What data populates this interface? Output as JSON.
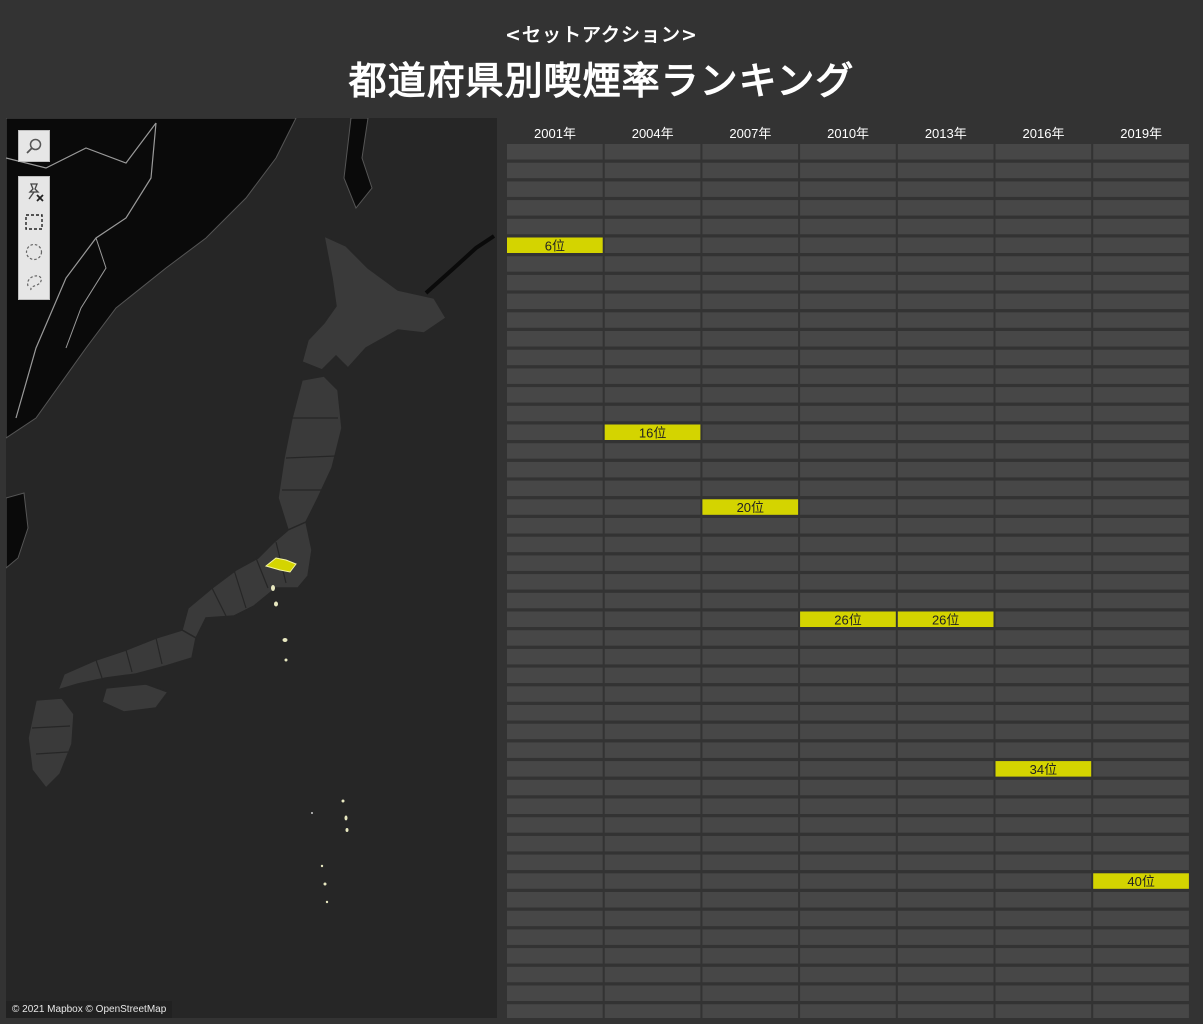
{
  "header": {
    "subtitle": "<セットアクション>",
    "title": "都道府県別喫煙率ランキング"
  },
  "map": {
    "attribution": "© 2021 Mapbox © OpenStreetMap",
    "tools": {
      "search": "search-icon",
      "clear_selection": "pin-clear-icon",
      "rect_select": "rectangle-select-icon",
      "radial_select": "radial-select-icon",
      "lasso_select": "lasso-select-icon"
    },
    "highlighted_region_color": "#d4d400"
  },
  "ranking": {
    "years": [
      "2001年",
      "2004年",
      "2007年",
      "2010年",
      "2013年",
      "2016年",
      "2019年"
    ],
    "total_rows": 47,
    "highlight_color": "#d4d400",
    "cell_color": "#474747",
    "entries": [
      {
        "year_index": 0,
        "rank": 6,
        "label": "6位"
      },
      {
        "year_index": 1,
        "rank": 16,
        "label": "16位"
      },
      {
        "year_index": 2,
        "rank": 20,
        "label": "20位"
      },
      {
        "year_index": 3,
        "rank": 26,
        "label": "26位"
      },
      {
        "year_index": 4,
        "rank": 26,
        "label": "26位"
      },
      {
        "year_index": 5,
        "rank": 34,
        "label": "34位"
      },
      {
        "year_index": 6,
        "rank": 40,
        "label": "40位"
      }
    ]
  }
}
